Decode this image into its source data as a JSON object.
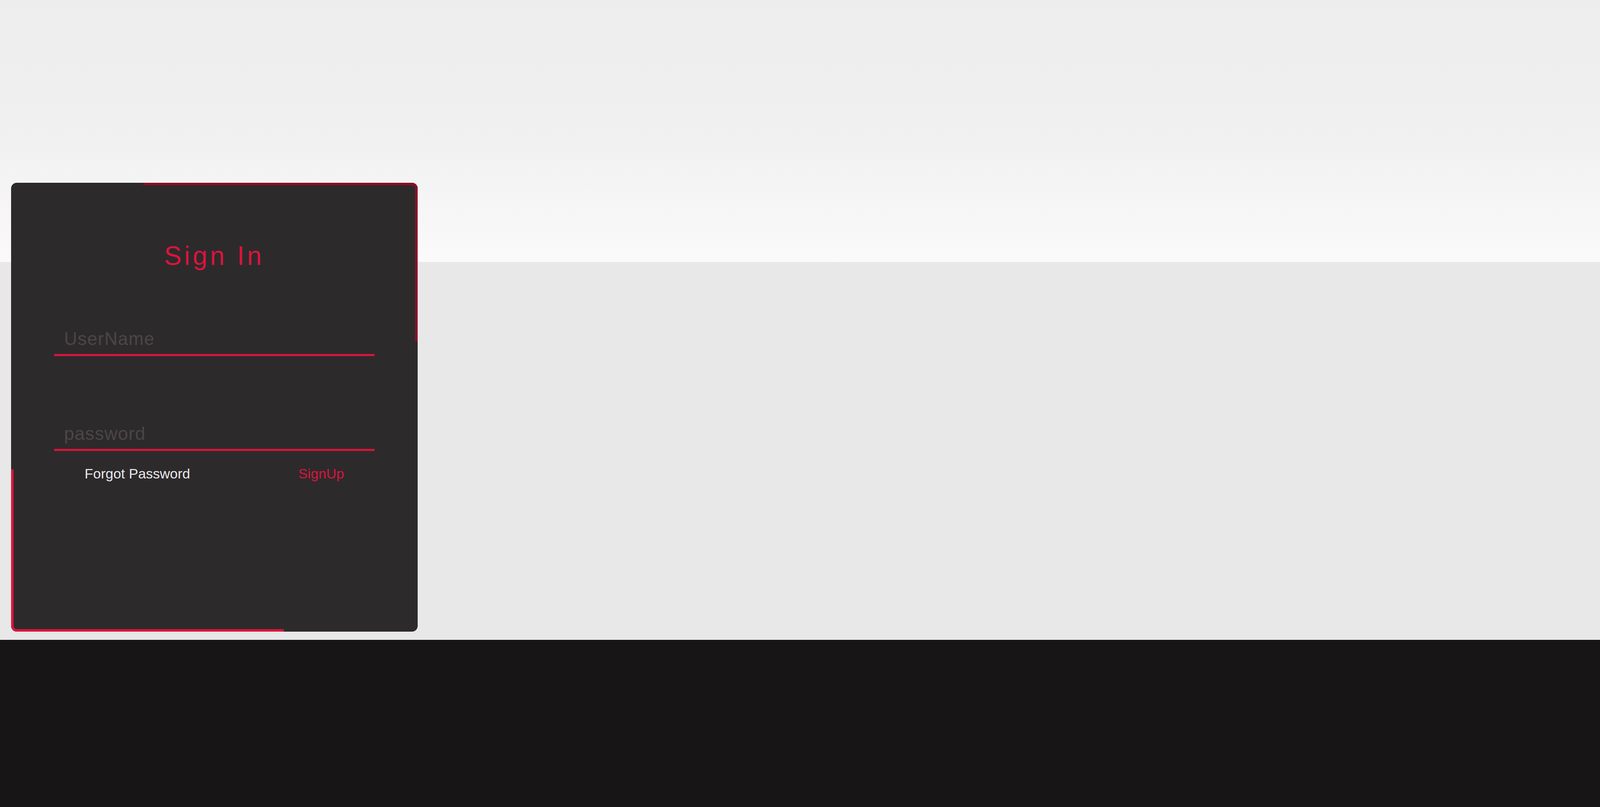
{
  "signin": {
    "title": "Sign In",
    "fields": [
      {
        "placeholder": "UserName",
        "type": "text"
      },
      {
        "placeholder": "password",
        "type": "password"
      }
    ],
    "links": [
      {
        "label": "Forgot Password",
        "accent": false
      },
      {
        "label": "SignUp",
        "accent": true
      }
    ]
  }
}
